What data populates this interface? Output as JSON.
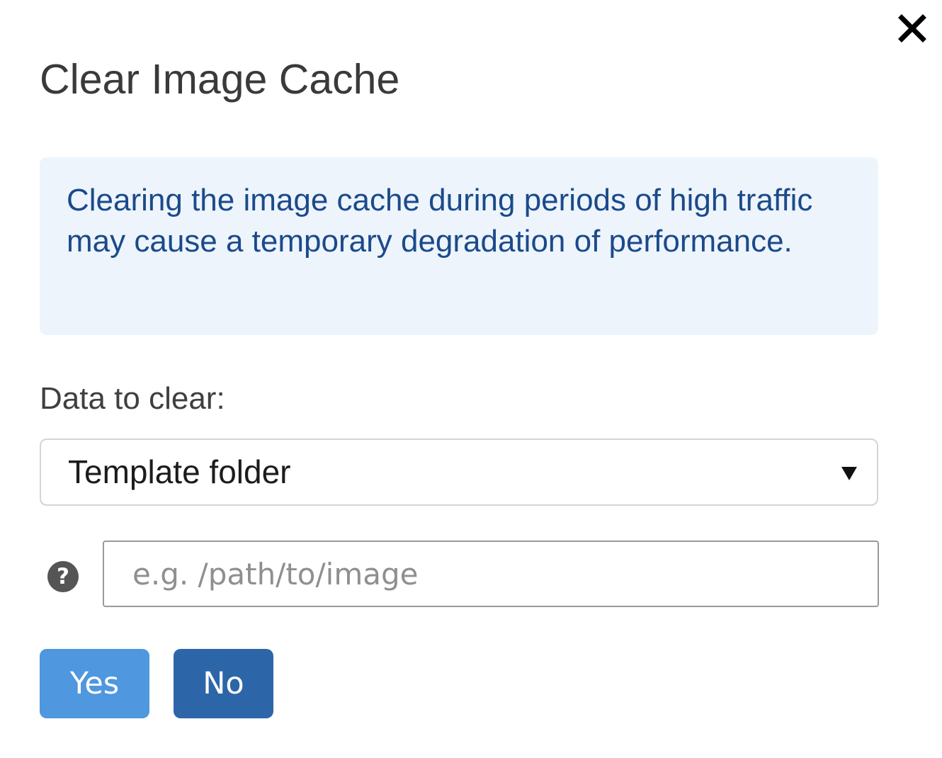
{
  "dialog": {
    "title": "Clear Image Cache",
    "close_icon": "close-icon",
    "alert": {
      "text": "Clearing the image cache during periods of high traffic may cause a temporary degradation of performance.",
      "background_color": "#edf4fc",
      "text_color": "#1b4a8a"
    },
    "data_to_clear": {
      "label": "Data to clear:",
      "selected": "Template folder"
    },
    "path_input": {
      "placeholder": "e.g. /path/to/image",
      "value": "",
      "help_icon": "question-circle-icon"
    },
    "buttons": {
      "yes_label": "Yes",
      "no_label": "No",
      "yes_color": "#4f97de",
      "no_color": "#2d66a8"
    }
  }
}
